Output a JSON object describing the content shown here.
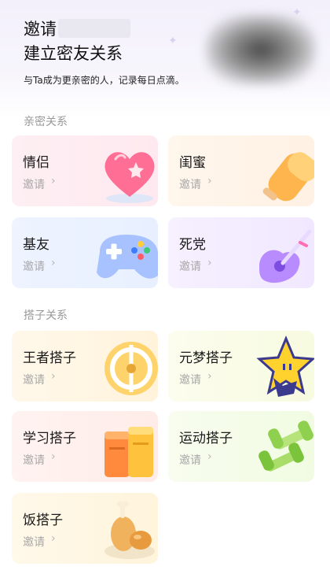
{
  "header": {
    "title_line1": "邀请",
    "title_line2": "建立密友关系",
    "subtitle": "与Ta成为更亲密的人，记录每日点滴。"
  },
  "sections": [
    {
      "title": "亲密关系",
      "cards": [
        {
          "title": "情侣",
          "action": "邀请",
          "icon": "heart-icon",
          "bg": "#fff0f4"
        },
        {
          "title": "闺蜜",
          "action": "邀请",
          "icon": "popsicle-icon",
          "bg": "#fff4e8"
        },
        {
          "title": "基友",
          "action": "邀请",
          "icon": "gamepad-icon",
          "bg": "#eef4ff"
        },
        {
          "title": "死党",
          "action": "邀请",
          "icon": "guitar-icon",
          "bg": "#f6efff"
        }
      ]
    },
    {
      "title": "搭子关系",
      "cards": [
        {
          "title": "王者搭子",
          "action": "邀请",
          "icon": "target-icon",
          "bg": "#fff7e6"
        },
        {
          "title": "元梦搭子",
          "action": "邀请",
          "icon": "star-character-icon",
          "bg": "#fbfde9"
        },
        {
          "title": "学习搭子",
          "action": "邀请",
          "icon": "books-icon",
          "bg": "#fff1ee"
        },
        {
          "title": "运动搭子",
          "action": "邀请",
          "icon": "dumbbell-icon",
          "bg": "#f6fdeb"
        },
        {
          "title": "饭搭子",
          "action": "邀请",
          "icon": "chicken-leg-icon",
          "bg": "#fff8e8"
        }
      ]
    }
  ]
}
